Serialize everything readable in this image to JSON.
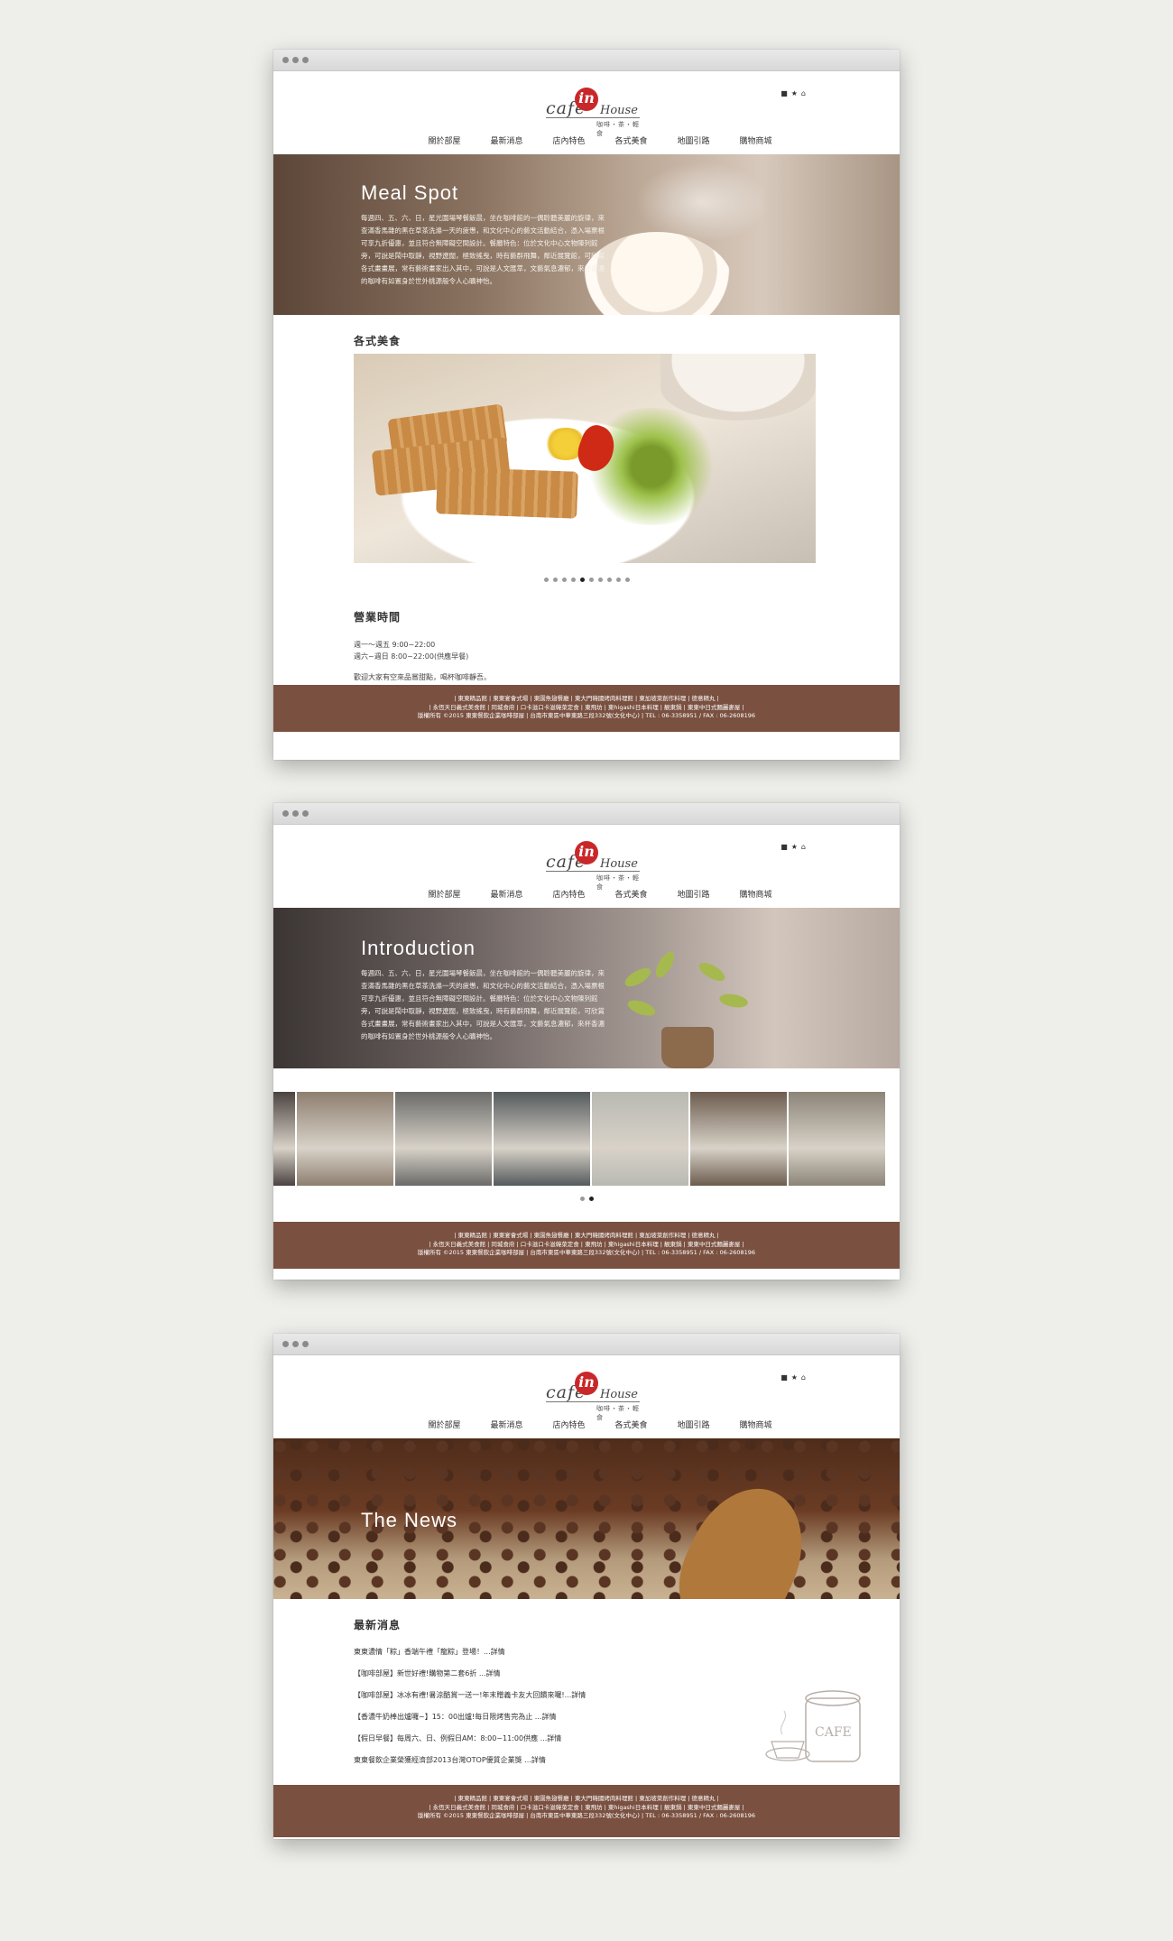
{
  "site": {
    "logo_main": "cafe",
    "logo_accent": "in",
    "logo_suffix": "House",
    "logo_tag": "咖啡・茶・輕食",
    "social_icons": [
      "facebook-icon",
      "star-icon",
      "home-icon"
    ]
  },
  "nav": [
    "關於部屋",
    "最新消息",
    "店內特色",
    "各式美食",
    "地圖引路",
    "購物商城"
  ],
  "footer": {
    "line1": "| 東東精品館 | 東東宴會式場 | 東園魚翅餐廳 | 東大門韓國烤肉料理館 | 東加坡菜創作料理 | 德意精丸 |",
    "line2": "| 永恆天日義式美食館 | 同城食府 | 口卡滋口卡滋韓菜定食 | 東飛坊 | 東higashi日本料理 | 靚東鍋 | 東東中日式麵麗麥屋 |",
    "line3": "版權所有 ©2015 東東餐飲企業咖啡部屋  |  台南市東區中華東路三段332號(文化中心)  |  TEL : 06-3358951 / FAX : 06-2608196"
  },
  "page1": {
    "hero_title": "Meal Spot",
    "hero_text": "每週四、五、六、日，星光圍場琴餐飯晨，坐在咖啡館的一偶聆聽美麗的旋律，來查滿香馬雜的黑在草茶洗滌一天的疲憊，和文化中心的藝文活動結合，憑入場票根可享九折優惠，並且符合無障礙空間設計。餐廳特色：位於文化中心文物陳列館旁，可說是鬧中取靜，視野遼闊，極致搖曳，時有藝群飛舞，鄰近展覽館，可欣賞各式畫畫展，常有藝術畫家出入其中，可說是人文匯萃，文藝氣息濃郁，來杯香濃的咖啡有如置身於世外桃源般令人心曠神怡。",
    "section_title": "各式美食",
    "slider_dots": 10,
    "slider_active": 4,
    "hours_title": "營業時間",
    "hours_line1": "週一～週五 9:00~22:00",
    "hours_line2": "週六~週日 8:00~22:00(供應早餐)",
    "hours_note": "歡迎大家有空來品嘗甜點，喝杯咖啡靜吾。"
  },
  "page2": {
    "hero_title": "Introduction",
    "hero_text": "每週四、五、六、日，星光圍場琴餐飯晨，坐在咖啡館的一偶聆聽美麗的旋律，來查滿香馬雜的黑在草茶洗滌一天的疲憊，和文化中心的藝文活動結合，憑入場票根可享九折優惠，並且符合無障礙空間設計。餐廳特色：位於文化中心文物陳列館旁，可說是鬧中取靜，視野遼闊，極致搖曳，時有藝群飛舞，鄰近展覽館，可欣賞各式畫畫展，常有藝術畫家出入其中，可說是人文匯萃，文藝氣息濃郁，來杯香濃的咖啡有如置身於世外桃源般令人心曠神怡。",
    "gallery_colors": [
      "#4b4340",
      "#8e7f70",
      "#6a6a68",
      "#545a5c",
      "#b8b9b2",
      "#6c5c4e",
      "#8c8478"
    ],
    "slider_dots": 2,
    "slider_active": 1
  },
  "page3": {
    "hero_title": "The News",
    "section_title": "最新消息",
    "news": [
      "東東濃情「粽」香端午禮「龍粽」登場！...詳情",
      "【咖啡部屋】新世好禮!購物第二套6折 ...詳情",
      "【咖啡部屋】冰冰有禮!暑涼酷賞一送一!年末贈義卡友大回饋來囉!...詳情",
      "【香濃牛奶棒出爐囉~】15：00出爐!每日限烤售完為止 ...詳情",
      "【假日早餐】每周六、日、例假日AM：8:00~11:00供應 ...詳情",
      "東東餐飲企業榮獲經濟部2013台灣OTOP優質企業獎 ...詳情"
    ],
    "sketch_label": "CAFE"
  }
}
